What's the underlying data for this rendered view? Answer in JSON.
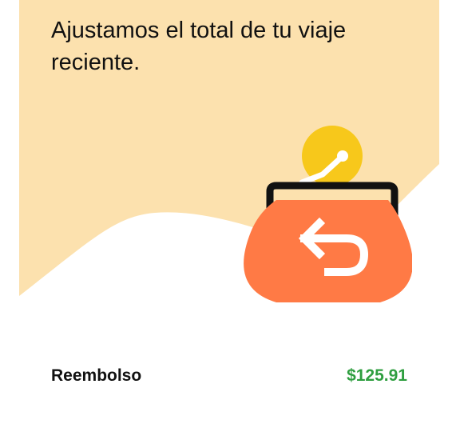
{
  "header": {
    "message": "Ajustamos el total de tu viaje reciente."
  },
  "illustration": {
    "icon": "refund-wallet-icon",
    "background_color": "#FCE1AE",
    "wallet_color": "#FF7A45",
    "coin_color": "#F7C81B"
  },
  "refund": {
    "label": "Reembolso",
    "amount": "$125.91",
    "amount_color": "#2E9E3F"
  }
}
